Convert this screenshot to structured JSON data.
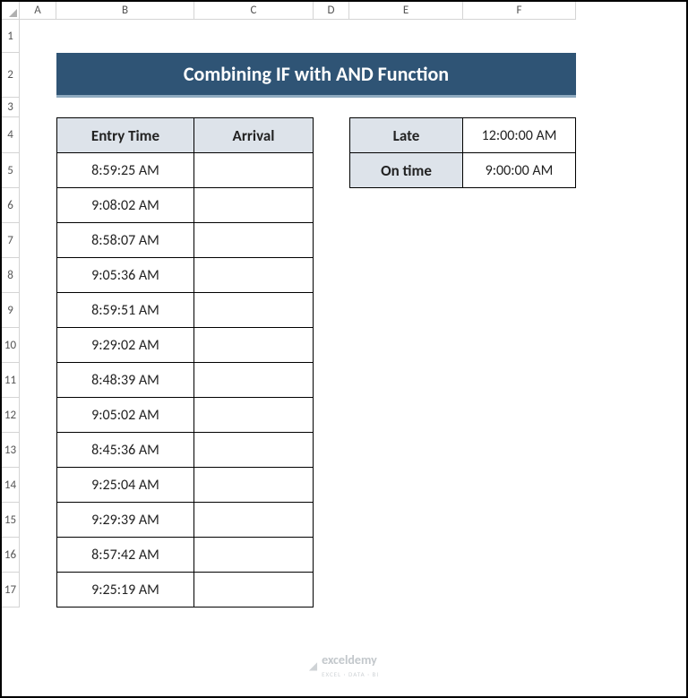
{
  "columns": [
    "A",
    "B",
    "C",
    "D",
    "E",
    "F"
  ],
  "rows": [
    "1",
    "2",
    "3",
    "4",
    "5",
    "6",
    "7",
    "8",
    "9",
    "10",
    "11",
    "12",
    "13",
    "14",
    "15",
    "16",
    "17"
  ],
  "banner": "Combining IF with AND Function",
  "table1": {
    "header": {
      "entry": "Entry Time",
      "arrival": "Arrival"
    },
    "rows": [
      {
        "entry": "8:59:25 AM",
        "arrival": ""
      },
      {
        "entry": "9:08:02 AM",
        "arrival": ""
      },
      {
        "entry": "8:58:07 AM",
        "arrival": ""
      },
      {
        "entry": "9:05:36 AM",
        "arrival": ""
      },
      {
        "entry": "8:59:51 AM",
        "arrival": ""
      },
      {
        "entry": "9:29:02 AM",
        "arrival": ""
      },
      {
        "entry": "8:48:39 AM",
        "arrival": ""
      },
      {
        "entry": "9:05:02 AM",
        "arrival": ""
      },
      {
        "entry": "8:45:36 AM",
        "arrival": ""
      },
      {
        "entry": "9:25:04 AM",
        "arrival": ""
      },
      {
        "entry": "9:29:39 AM",
        "arrival": ""
      },
      {
        "entry": "8:57:42 AM",
        "arrival": ""
      },
      {
        "entry": "9:25:19 AM",
        "arrival": ""
      }
    ]
  },
  "table2": {
    "rows": [
      {
        "label": "Late",
        "value": "12:00:00 AM"
      },
      {
        "label": "On time",
        "value": "9:00:00 AM"
      }
    ]
  },
  "watermark": {
    "brand": "exceldemy",
    "tag": "EXCEL · DATA · BI"
  }
}
